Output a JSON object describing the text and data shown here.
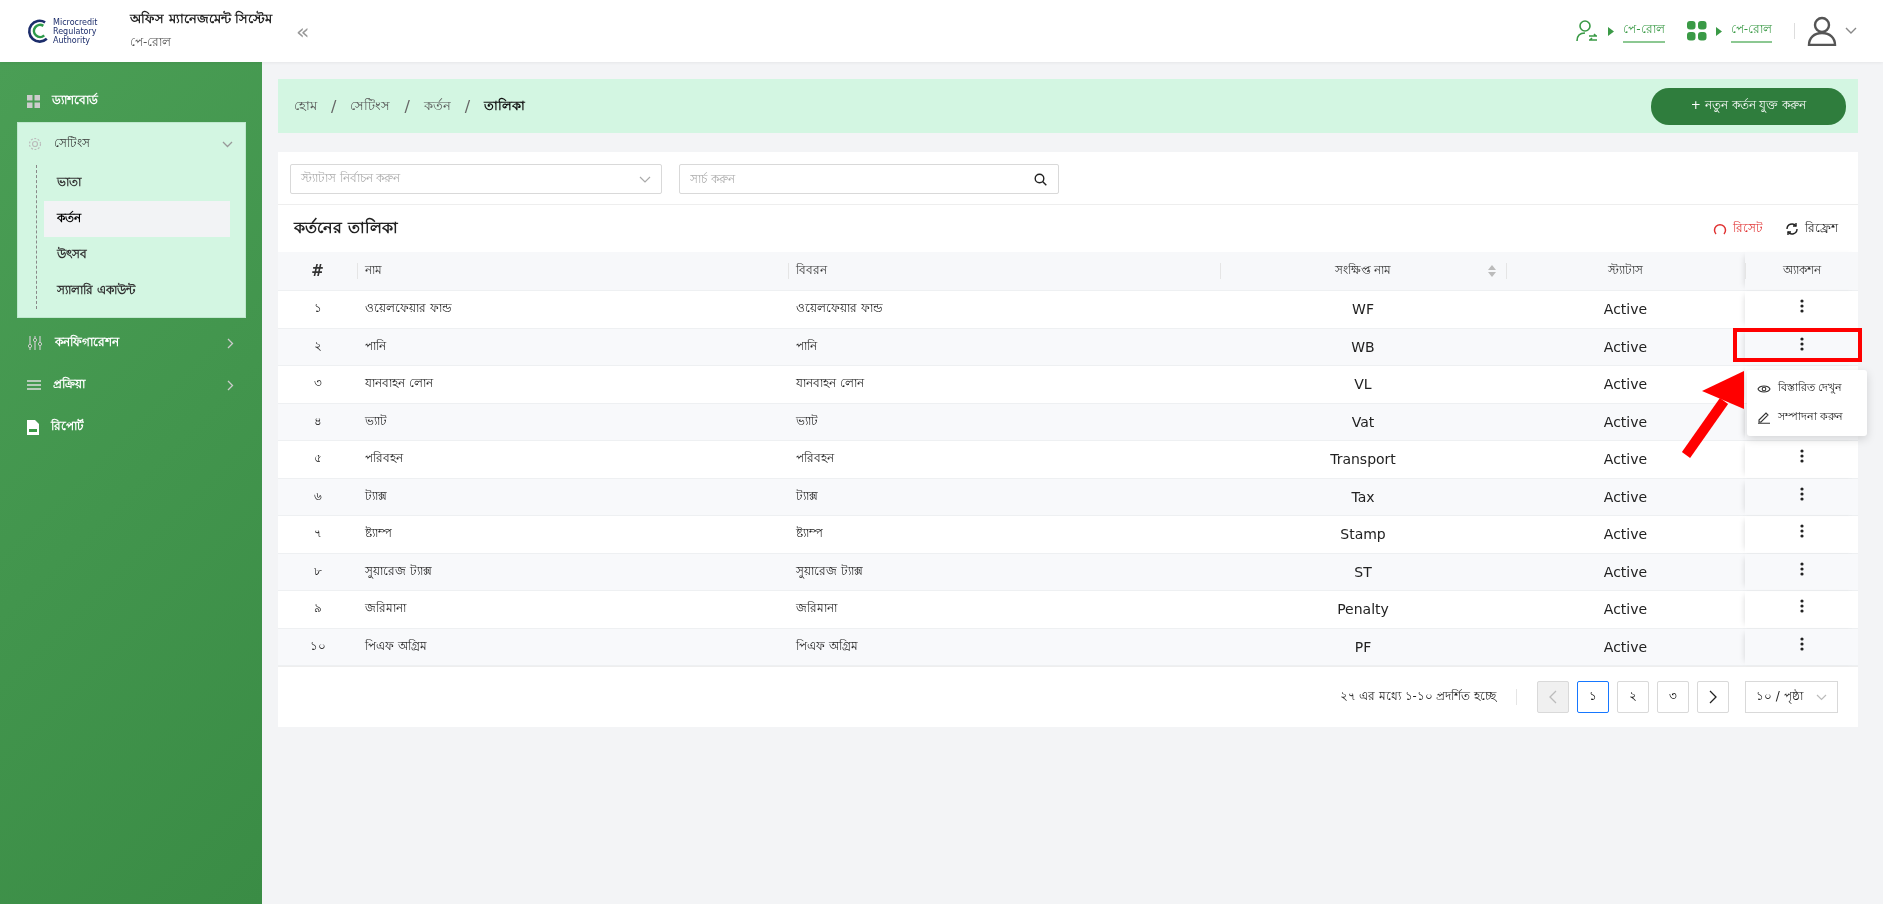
{
  "header": {
    "logo_lines": [
      "Microcredit",
      "Regulatory",
      "Authority"
    ],
    "title": "অফিস ম্যানেজমেন্ট সিস্টেম",
    "subtitle": "পে-রোল",
    "collapse": "«",
    "links": [
      {
        "label": "পে-রোল"
      },
      {
        "label": "পে-রোল"
      }
    ]
  },
  "sidebar": {
    "items": [
      {
        "label": "ড্যাশবোর্ড",
        "selected": false
      },
      {
        "label": "সেটিংস",
        "selected": false,
        "expanded": true,
        "children": [
          {
            "label": "ভাতা",
            "selected": false
          },
          {
            "label": "কর্তন",
            "selected": true
          },
          {
            "label": "উৎসব",
            "selected": false
          },
          {
            "label": "স্যালারি একাউন্ট",
            "selected": false
          }
        ]
      },
      {
        "label": "কনফিগারেশন",
        "selected": false,
        "expanded": false
      },
      {
        "label": "প্রক্রিয়া",
        "selected": false,
        "expanded": false
      },
      {
        "label": "রিপোর্ট",
        "selected": false
      }
    ]
  },
  "breadcrumb": [
    "হোম",
    "সেটিংস",
    "কর্তন",
    "তালিকা"
  ],
  "breadcrumb_separator": "/",
  "add_button": "+ নতুন কর্তন যুক্ত করুন",
  "filters": {
    "status": {
      "placeholder": "স্ট্যাটাস নির্বাচন করুন"
    },
    "search": {
      "placeholder": "সার্চ করুন"
    }
  },
  "table_title": "কর্তনের তালিকা",
  "reset": "রিসেট",
  "refresh": "রিফ্রেশ",
  "table": {
    "columns": [
      "#",
      "নাম",
      "বিবরন",
      "সংক্ষিপ্ত নাম",
      "স্ট্যাটাস",
      "অ্যাকশন"
    ],
    "rows": [
      {
        "no": "১",
        "name": "ওয়েলফেয়ার ফান্ড",
        "description": "ওয়েলফেয়ার ফান্ড",
        "short": "WF",
        "status": "Active",
        "highlighted": false
      },
      {
        "no": "২",
        "name": "পানি",
        "description": "পানি",
        "short": "WB",
        "status": "Active",
        "highlighted": true,
        "menu": [
          {
            "label": "বিস্তারিত দেখুন"
          },
          {
            "label": "সম্পাদনা করুন"
          }
        ]
      },
      {
        "no": "৩",
        "name": "যানবাহন লোন",
        "description": "যানবাহন লোন",
        "short": "VL",
        "status": "Active",
        "highlighted": false
      },
      {
        "no": "৪",
        "name": "ভ্যাট",
        "description": "ভ্যাট",
        "short": "Vat",
        "status": "Active",
        "highlighted": false
      },
      {
        "no": "৫",
        "name": "পরিবহন",
        "description": "পরিবহন",
        "short": "Transport",
        "status": "Active",
        "highlighted": false
      },
      {
        "no": "৬",
        "name": "ট্যাক্স",
        "description": "ট্যাক্স",
        "short": "Tax",
        "status": "Active",
        "highlighted": false
      },
      {
        "no": "৭",
        "name": "ষ্ট্যাম্প",
        "description": "ষ্ট্যাম্প",
        "short": "Stamp",
        "status": "Active",
        "highlighted": false
      },
      {
        "no": "৮",
        "name": "সুয়ারেজ ট্যাক্স",
        "description": "সুয়ারেজ ট্যাক্স",
        "short": "ST",
        "status": "Active",
        "highlighted": false
      },
      {
        "no": "৯",
        "name": "জরিমানা",
        "description": "জরিমানা",
        "short": "Penalty",
        "status": "Active",
        "highlighted": false
      },
      {
        "no": "১০",
        "name": "পিএফ অগ্রিম",
        "description": "পিএফ অগ্রিম",
        "short": "PF",
        "status": "Active",
        "highlighted": false
      }
    ]
  },
  "pagination": {
    "info": "২৭ এর মধ্যে ১-১০ প্রদর্শিত হচ্ছে",
    "prev_disabled": true,
    "next_disabled": false,
    "pages": [
      {
        "label": "১",
        "selected": true
      },
      {
        "label": "২",
        "selected": false
      },
      {
        "label": "৩",
        "selected": false
      }
    ],
    "page_size": "১০ / পৃষ্ঠা"
  }
}
